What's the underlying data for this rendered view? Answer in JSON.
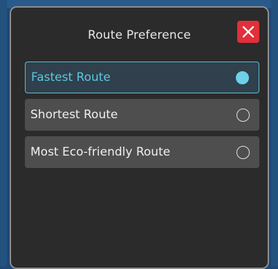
{
  "dialog": {
    "title": "Route Preference",
    "close_icon": "close-icon"
  },
  "options": [
    {
      "label": "Fastest Route",
      "selected": true
    },
    {
      "label": "Shortest Route",
      "selected": false
    },
    {
      "label": "Most Eco-friendly Route",
      "selected": false
    }
  ],
  "colors": {
    "accent": "#5cc8e2",
    "close_button": "#e0303a",
    "dialog_bg": "#2b2b2b",
    "option_bg": "#4e4e4e"
  }
}
